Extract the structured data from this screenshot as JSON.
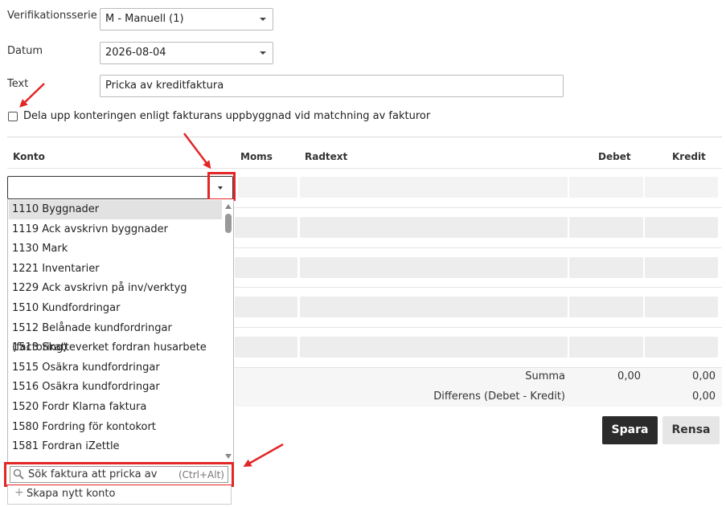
{
  "form": {
    "series_label": "Verifikationsserie",
    "series_value": "M - Manuell (1)",
    "date_label": "Datum",
    "date_value": "2026-08-04",
    "text_label": "Text",
    "text_value": "Pricka av kreditfaktura",
    "split_checkbox_label": "Dela upp konteringen enligt fakturans uppbyggnad vid matchning av fakturor",
    "split_checked": false
  },
  "table": {
    "headers": {
      "konto": "Konto",
      "moms": "Moms",
      "radtext": "Radtext",
      "debet": "Debet",
      "kredit": "Kredit"
    },
    "konto_input_value": ""
  },
  "dropdown": {
    "items": [
      "1110 Byggnader",
      "1119 Ack avskrivn byggnader",
      "1130 Mark",
      "1221 Inventarier",
      "1229 Ack avskrivn på inv/verktyg",
      "1510 Kundfordringar",
      "1512 Belånade kundfordringar (factoring)",
      "1513 Skatteverket fordran husarbete",
      "1515 Osäkra kundfordringar",
      "1516 Osäkra kundfordringar",
      "1520 Fordr Klarna faktura",
      "1580 Fordring för kontokort",
      "1581 Fordran iZettle"
    ],
    "selected_index": 0,
    "search_label": "Sök faktura att pricka av",
    "search_shortcut": "(Ctrl+Alt)",
    "create_label": "Skapa nytt konto"
  },
  "totals": {
    "summa_label": "Summa",
    "summa_debet": "0,00",
    "summa_kredit": "0,00",
    "diff_label": "Differens (Debet - Kredit)",
    "diff_value": "0,00"
  },
  "buttons": {
    "save": "Spara",
    "clear": "Rensa"
  },
  "colors": {
    "annotation": "#e32626",
    "primary_button": "#2b2b2b"
  }
}
